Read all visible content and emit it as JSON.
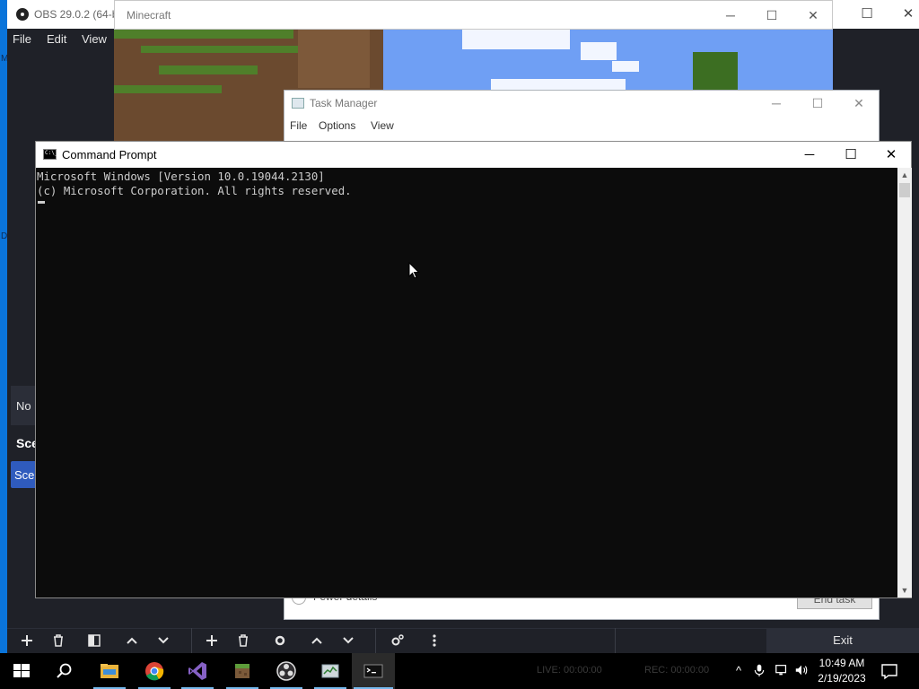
{
  "obs": {
    "title": "OBS 29.0.2 (64-bi",
    "menu": [
      "File",
      "Edit",
      "View"
    ],
    "no_source_label": "No",
    "scenes_header": "Sce",
    "scene_item": "Sce",
    "exit_label": "Exit",
    "toolbar_icons": [
      "plus-icon",
      "trash-icon",
      "filter-icon",
      "chevron-up-icon",
      "chevron-down-icon",
      "plus-icon",
      "trash-icon",
      "gear-icon",
      "chevron-up-icon",
      "chevron-down-icon",
      "gears-icon",
      "more-vertical-icon"
    ]
  },
  "minecraft": {
    "title": "Minecraft"
  },
  "task_manager": {
    "title": "Task Manager",
    "menu": [
      "File",
      "Options",
      "View"
    ],
    "fewer_details": "Fewer details",
    "end_task": "End task"
  },
  "cmd": {
    "title": "Command Prompt",
    "lines": [
      "Microsoft Windows [Version 10.0.19044.2130]",
      "(c) Microsoft Corporation. All rights reserved."
    ]
  },
  "taskbar": {
    "apps": [
      "start-icon",
      "search-icon",
      "file-explorer-icon",
      "chrome-icon",
      "visual-studio-icon",
      "minecraft-icon",
      "obs-icon",
      "task-manager-icon",
      "command-prompt-icon"
    ],
    "live": "LIVE: 00:00:00",
    "rec": "REC: 00:00:00",
    "time": "10:49 AM",
    "date": "2/19/2023"
  },
  "colors": {
    "accent": "#76b9ed",
    "obs_bg": "#1f2128",
    "cmd_bg": "#0c0c0c",
    "scene_selected": "#2f5bbd"
  }
}
